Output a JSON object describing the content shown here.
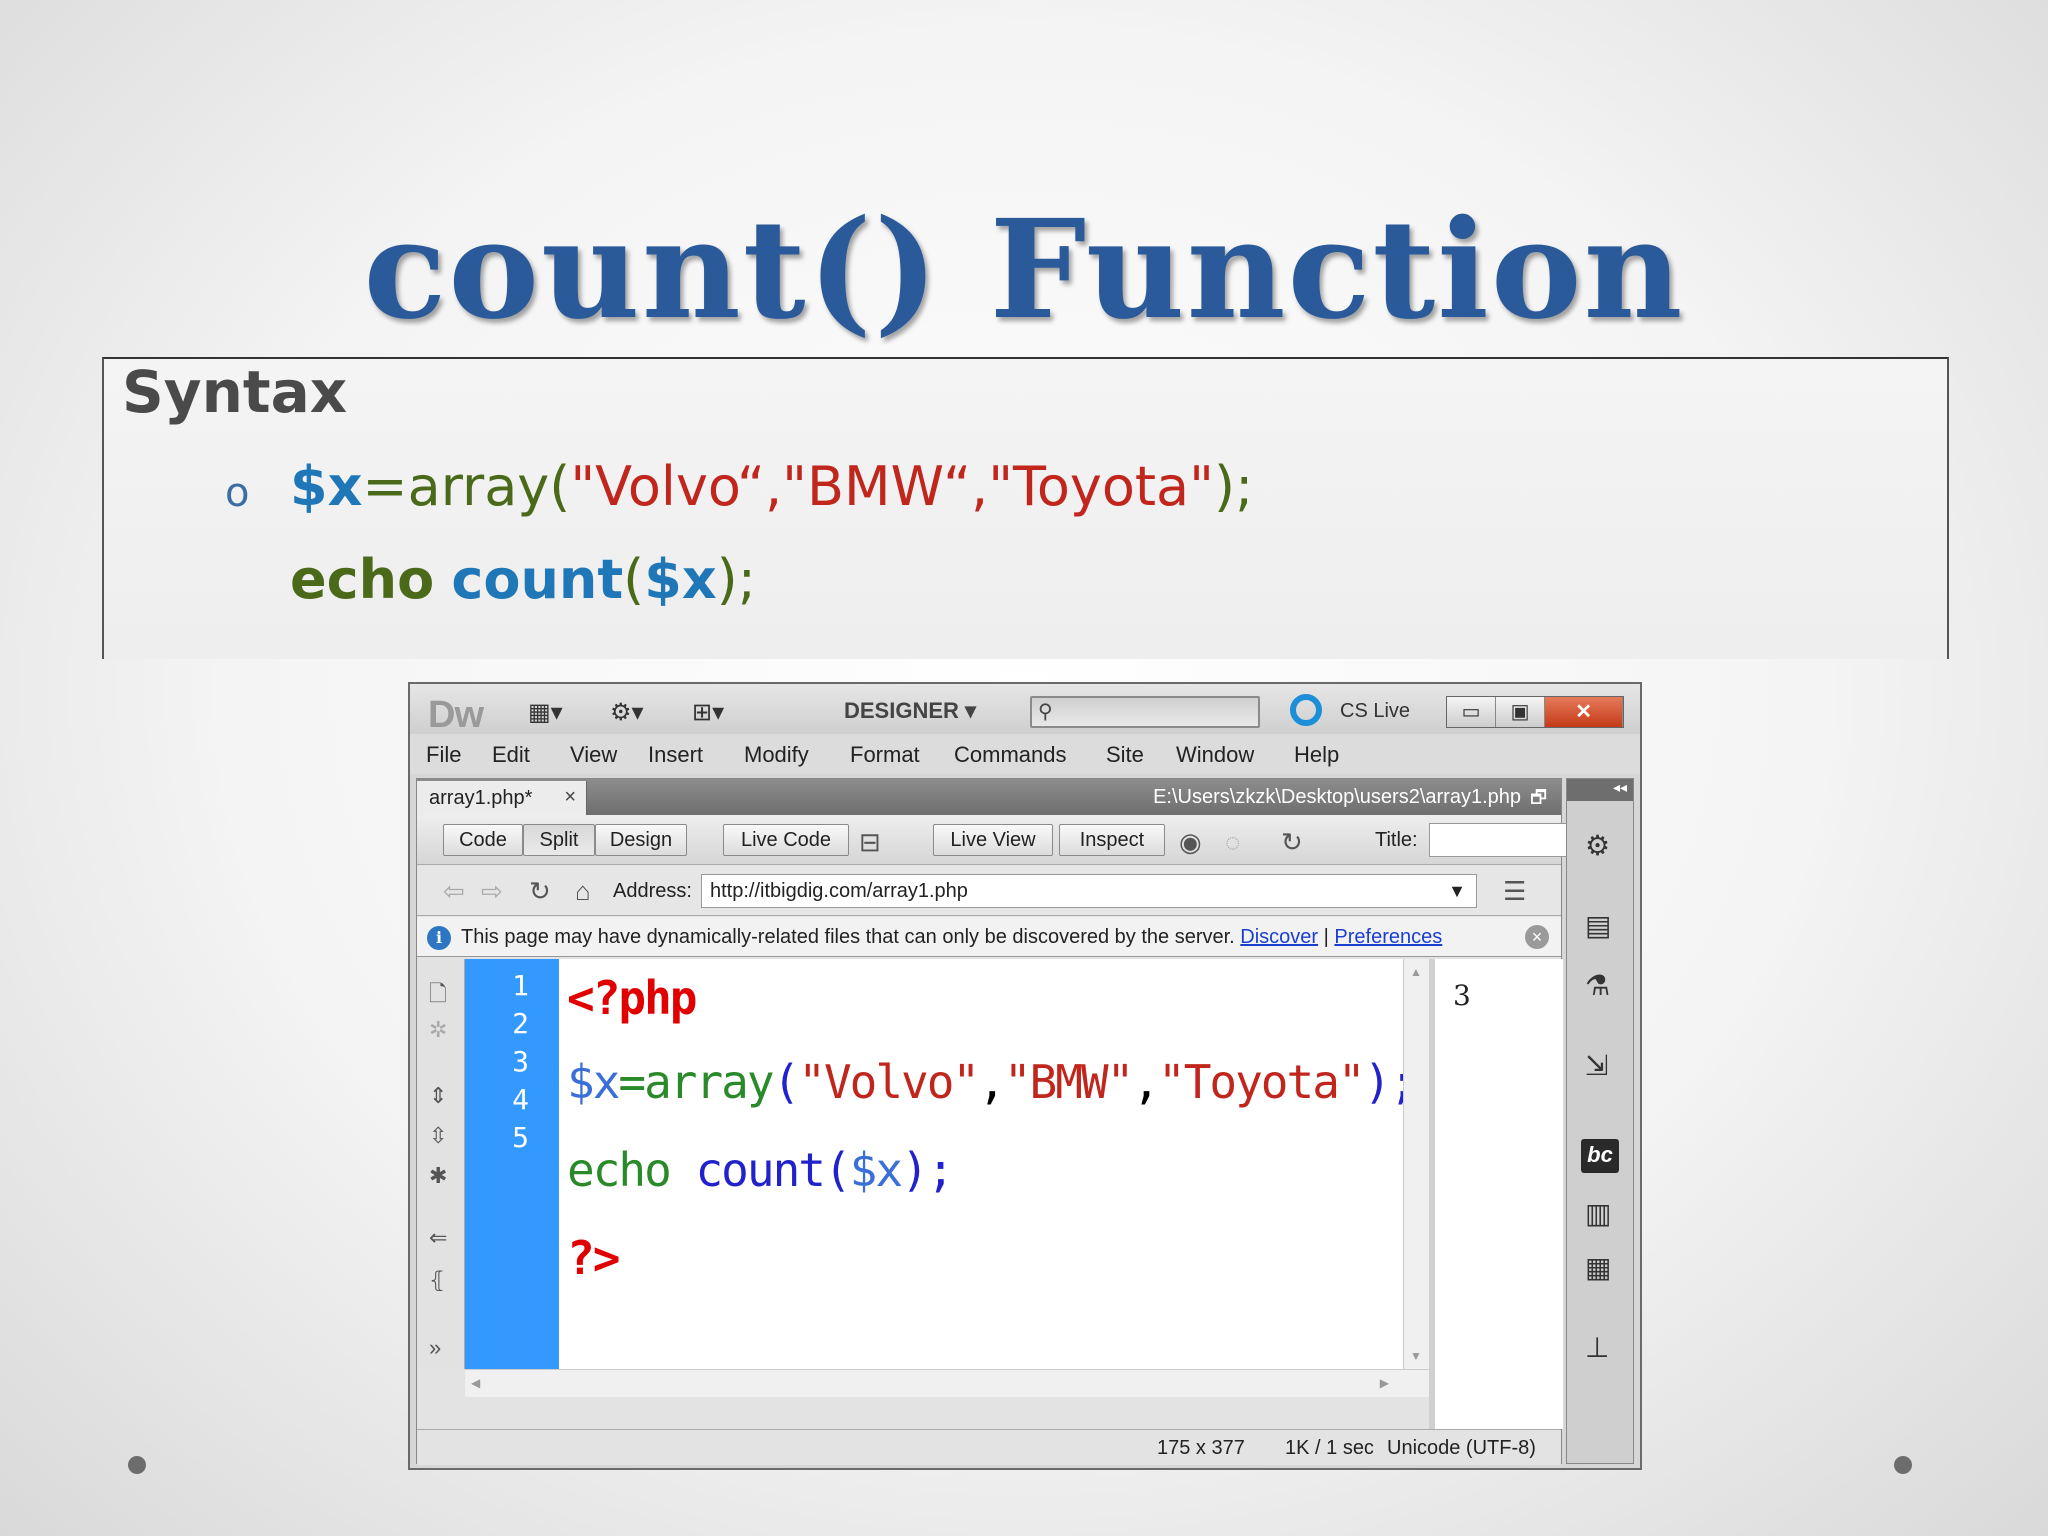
{
  "slide": {
    "title": "count() Function",
    "section_heading": "Syntax",
    "bullet_glyph": "o",
    "code_line1": {
      "var": "$x",
      "eq_array": "=array(",
      "args": "\"Volvo“,\"BMW“,\"Toyota\"",
      "close": ");"
    },
    "code_line2": {
      "echo": "echo",
      "count": "count",
      "open": "(",
      "var": "$x",
      "close": ");"
    }
  },
  "dreamweaver": {
    "logo": "Dw",
    "workspace": "DESIGNER",
    "cs_live": "CS Live",
    "menu": [
      "File",
      "Edit",
      "View",
      "Insert",
      "Modify",
      "Format",
      "Commands",
      "Site",
      "Window",
      "Help"
    ],
    "tab": {
      "name": "array1.php*",
      "close": "×"
    },
    "file_path": "E:\\Users\\zkzk\\Desktop\\users2\\array1.php",
    "view_buttons": {
      "code": "Code",
      "split": "Split",
      "design": "Design",
      "live_code": "Live Code",
      "live_view": "Live View",
      "inspect": "Inspect"
    },
    "title_label": "Title:",
    "title_value": "",
    "address_label": "Address:",
    "address_value": "http://itbigdig.com/array1.php",
    "info": {
      "message": "This page may have dynamically-related files that can only be discovered by the server.",
      "discover": "Discover",
      "separator": "|",
      "preferences": "Preferences"
    },
    "line_numbers": [
      "1",
      "2",
      "3",
      "4",
      "5"
    ],
    "code": {
      "l1": "<?php",
      "l2_var": "$x",
      "l2_fn": "=array",
      "l2_open": "(",
      "l2_s1": "\"Volvo\"",
      "l2_c1": ",",
      "l2_s2": "\"BMW\"",
      "l2_c2": ",",
      "l2_s3": "\"Toyota\"",
      "l2_close": ");",
      "l3_echo": "echo",
      "l3_count": "count",
      "l3_open": "(",
      "l3_var": "$x",
      "l3_close": ");",
      "l4": "?>"
    },
    "live_output": "3",
    "status": {
      "dimensions": "175 x 377",
      "size": "1K / 1 sec",
      "encoding": "Unicode (UTF-8)"
    }
  },
  "colors": {
    "title": "#2a5a9a",
    "gutter": "#3399ff",
    "link": "#1a3fd0"
  }
}
